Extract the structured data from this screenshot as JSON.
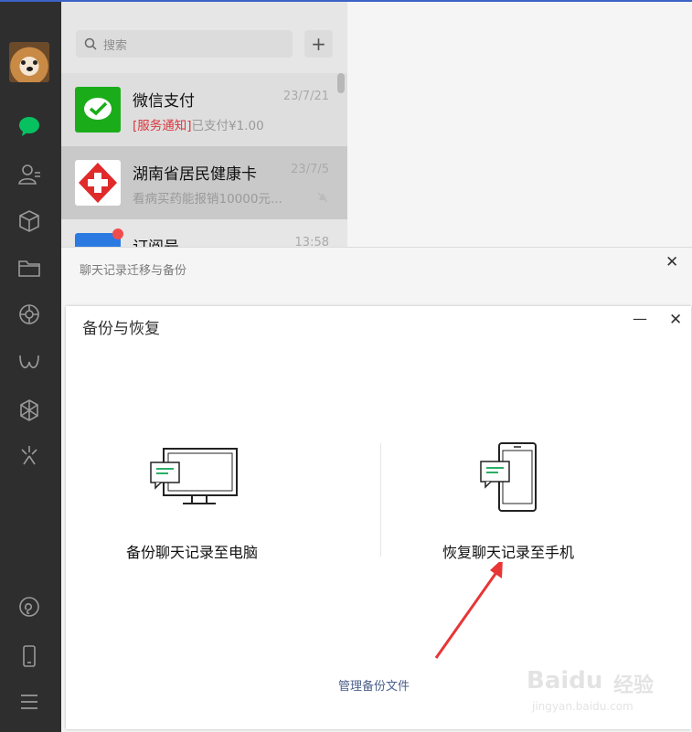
{
  "search": {
    "placeholder": "搜索"
  },
  "chats": [
    {
      "name": "微信支付",
      "time": "23/7/21",
      "tag": "[服务通知]",
      "preview": "已支付¥1.00",
      "color": "#1aad19"
    },
    {
      "name": "湖南省居民健康卡",
      "time": "23/7/5",
      "preview": "看病买药能报销10000元...",
      "muted": true,
      "color": "#e02b2b"
    },
    {
      "name": "订阅号",
      "time": "13:58",
      "color": "#2a7ae2",
      "unread_dot": true
    }
  ],
  "migrate_dialog": {
    "title": "聊天记录迁移与备份"
  },
  "backup_dialog": {
    "title": "备份与恢复",
    "option_pc": "备份聊天记录至电脑",
    "option_phone": "恢复聊天记录至手机",
    "manage_link": "管理备份文件"
  },
  "watermark": {
    "brand": "Baidu",
    "cn": "经验",
    "url": "jingyan.baidu.com"
  },
  "colors": {
    "accent_green": "#07c160",
    "annotation_arrow": "#e83535",
    "rail_bg": "#2e2e2e"
  }
}
